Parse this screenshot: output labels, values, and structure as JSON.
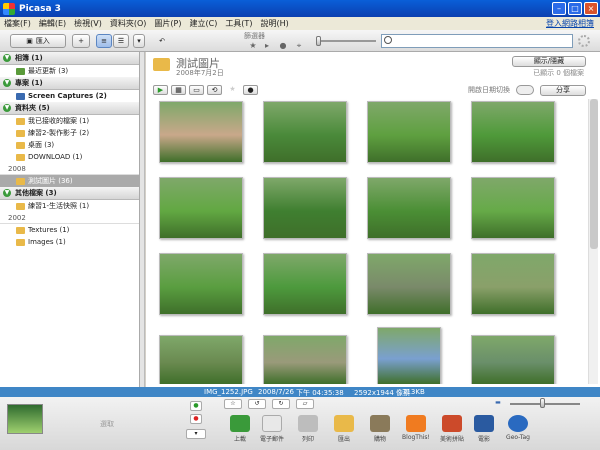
{
  "window": {
    "title": "Picasa 3"
  },
  "menu": [
    "檔案(F)",
    "編輯(E)",
    "檢視(V)",
    "資料夾(O)",
    "圖片(P)",
    "建立(C)",
    "工具(T)",
    "說明(H)"
  ],
  "menu_signin": "登入網路相簿",
  "toolbar": {
    "import_label": "匯入",
    "filter_label": "篩選器",
    "search_value": ""
  },
  "sidebar": {
    "sections": [
      {
        "title": "相簿 (1)",
        "items": [
          {
            "label": "最近更新 (3)",
            "icon": "recent-icon"
          }
        ]
      },
      {
        "title": "專案 (1)",
        "items": [
          {
            "label": "Screen Captures (2)",
            "icon": "capture-icon",
            "bold": true
          }
        ]
      },
      {
        "title": "資料夾 (5)",
        "items": [
          {
            "label": "我已接收的檔案 (1)"
          },
          {
            "label": "練習2-製作影子 (2)"
          },
          {
            "label": "桌面 (3)"
          },
          {
            "label": "DOWNLOAD (1)"
          }
        ]
      },
      {
        "year": "2008",
        "items": [
          {
            "label": "測試圖片 (36)",
            "selected": true
          }
        ]
      },
      {
        "title": "其他檔案 (3)",
        "items": [
          {
            "label": "練習1-生活快照 (1)"
          }
        ]
      },
      {
        "year": "2002",
        "items": [
          {
            "label": "Textures (1)"
          },
          {
            "label": "Images (1)"
          }
        ]
      }
    ]
  },
  "album": {
    "title": "測試圖片",
    "date": "2008年7月2日",
    "edit_button": "顯示/隱藏",
    "selected_count": "已顯示 0 個檔案",
    "share_button": "分享",
    "date_toggle_label": "開啟日期切換"
  },
  "status": {
    "filename": "IMG_1252.JPG",
    "date": "2008/7/26",
    "time": "下午 04:35:38",
    "dimensions": "2592x1944 像素",
    "size": "713KB"
  },
  "tray": {
    "hold_label": "選取",
    "actions": [
      {
        "label": "上載",
        "icon": "upload-icon",
        "color": "#3a9a3a"
      },
      {
        "label": "電子郵件",
        "icon": "email-icon",
        "color": "#e8e8e8"
      },
      {
        "label": "列印",
        "icon": "print-icon",
        "color": "#bdbdbd"
      },
      {
        "label": "匯出",
        "icon": "export-icon",
        "color": "#e9b949"
      },
      {
        "label": "購物",
        "icon": "shop-icon",
        "color": "#8a7a5a"
      },
      {
        "label": "BlogThis!",
        "icon": "blog-icon",
        "color": "#f07b20"
      },
      {
        "label": "美術拼貼",
        "icon": "collage-icon",
        "color": "#cc4a2a"
      },
      {
        "label": "電影",
        "icon": "movie-icon",
        "color": "#2a5aa0"
      },
      {
        "label": "Geo-Tag",
        "icon": "geotag-icon",
        "color": "#2a6ac0"
      }
    ]
  },
  "photos": [
    "#c9a88a",
    "#4a8a3a",
    "#5fa040",
    "#4f9a3a",
    "#62a842",
    "#3f7f30",
    "#4b8f35",
    "#66aa48",
    "#5a9e40",
    "#4d9a3d",
    "#7a8a6a",
    "#8aa06a",
    "#6a8a50",
    "#9a9a7a",
    "#7aa0d0",
    "#6a8f6a",
    "#5a7a4a",
    "#7a9a7a"
  ]
}
